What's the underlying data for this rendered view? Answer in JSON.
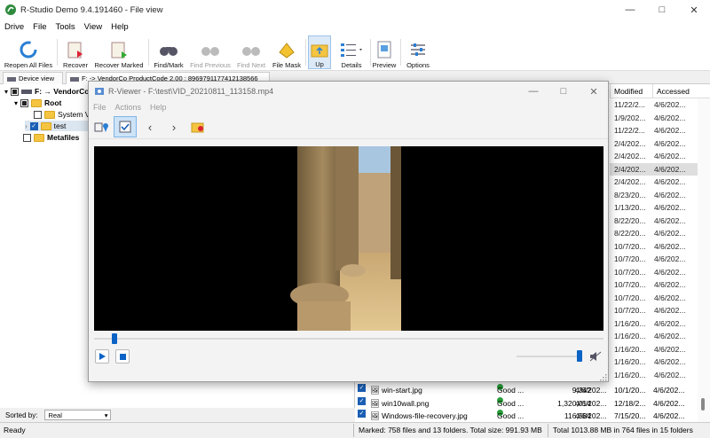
{
  "window": {
    "title": "R-Studio Demo 9.4.191460 - File view"
  },
  "menu": [
    "Drive",
    "File",
    "Tools",
    "View",
    "Help"
  ],
  "toolbar": {
    "reopen": "Reopen All Files",
    "recover": "Recover",
    "recover_marked": "Recover Marked",
    "find_mark": "Find/Mark",
    "find_previous": "Find Previous",
    "find_next": "Find Next",
    "file_mask": "File Mask",
    "up": "Up",
    "details": "Details",
    "preview": "Preview",
    "options": "Options"
  },
  "tabs": {
    "device_view": "Device view",
    "drive_tab": "F: -> VendorCo ProductCode 2.00 : 8969791177412138566"
  },
  "tree": {
    "drive": "F: → VendorCo",
    "root": "Root",
    "system": "System Vo",
    "test": "test",
    "metafiles": "Metafiles"
  },
  "sortbar": {
    "label": "Sorted by:",
    "value": "Real"
  },
  "columns": {
    "modified": "Modified",
    "accessed": "Accessed"
  },
  "rows": [
    {
      "m": "11/22/2...",
      "a": "4/6/202..."
    },
    {
      "m": "1/9/202...",
      "a": "4/6/202..."
    },
    {
      "m": "11/22/2...",
      "a": "4/6/202..."
    },
    {
      "m": "2/4/202...",
      "a": "4/6/202..."
    },
    {
      "m": "2/4/202...",
      "a": "4/6/202..."
    },
    {
      "m": "2/4/202...",
      "a": "4/6/202..."
    },
    {
      "m": "2/4/202...",
      "a": "4/6/202..."
    },
    {
      "m": "8/23/20...",
      "a": "4/6/202..."
    },
    {
      "m": "1/13/20...",
      "a": "4/6/202..."
    },
    {
      "m": "8/22/20...",
      "a": "4/6/202..."
    },
    {
      "m": "8/22/20...",
      "a": "4/6/202..."
    },
    {
      "m": "10/7/20...",
      "a": "4/6/202..."
    },
    {
      "m": "10/7/20...",
      "a": "4/6/202..."
    },
    {
      "m": "10/7/20...",
      "a": "4/6/202..."
    },
    {
      "m": "10/7/20...",
      "a": "4/6/202..."
    },
    {
      "m": "10/7/20...",
      "a": "4/6/202..."
    },
    {
      "m": "10/7/20...",
      "a": "4/6/202..."
    },
    {
      "m": "1/16/20...",
      "a": "4/6/202..."
    },
    {
      "m": "1/16/20...",
      "a": "4/6/202..."
    },
    {
      "m": "1/16/20...",
      "a": "4/6/202..."
    },
    {
      "m": "1/16/20...",
      "a": "4/6/202..."
    },
    {
      "m": "1/16/20...",
      "a": "4/6/202..."
    }
  ],
  "files": [
    {
      "name": "win-start.jpg",
      "state": "Good ...",
      "size": "9,342",
      "created": "4/6/202...",
      "m": "10/1/20...",
      "a": "4/6/202..."
    },
    {
      "name": "win10wall.png",
      "state": "Good ...",
      "size": "1,320,014",
      "created": "4/6/202...",
      "m": "12/18/2...",
      "a": "4/6/202..."
    },
    {
      "name": "Windows-file-recovery.jpg",
      "state": "Good ...",
      "size": "116,584",
      "created": "4/6/202...",
      "m": "7/15/20...",
      "a": "4/6/202..."
    }
  ],
  "status": {
    "ready": "Ready",
    "marked": "Marked: 758 files and 13 folders. Total size: 991.93 MB",
    "total": "Total 1013.88 MB in 764 files in 15 folders"
  },
  "viewer": {
    "title": "R-Viewer - F:\\test\\VID_20210811_113158.mp4",
    "menu": [
      "File",
      "Actions",
      "Help"
    ],
    "seek_position": 0.04,
    "volume": 1.0
  }
}
